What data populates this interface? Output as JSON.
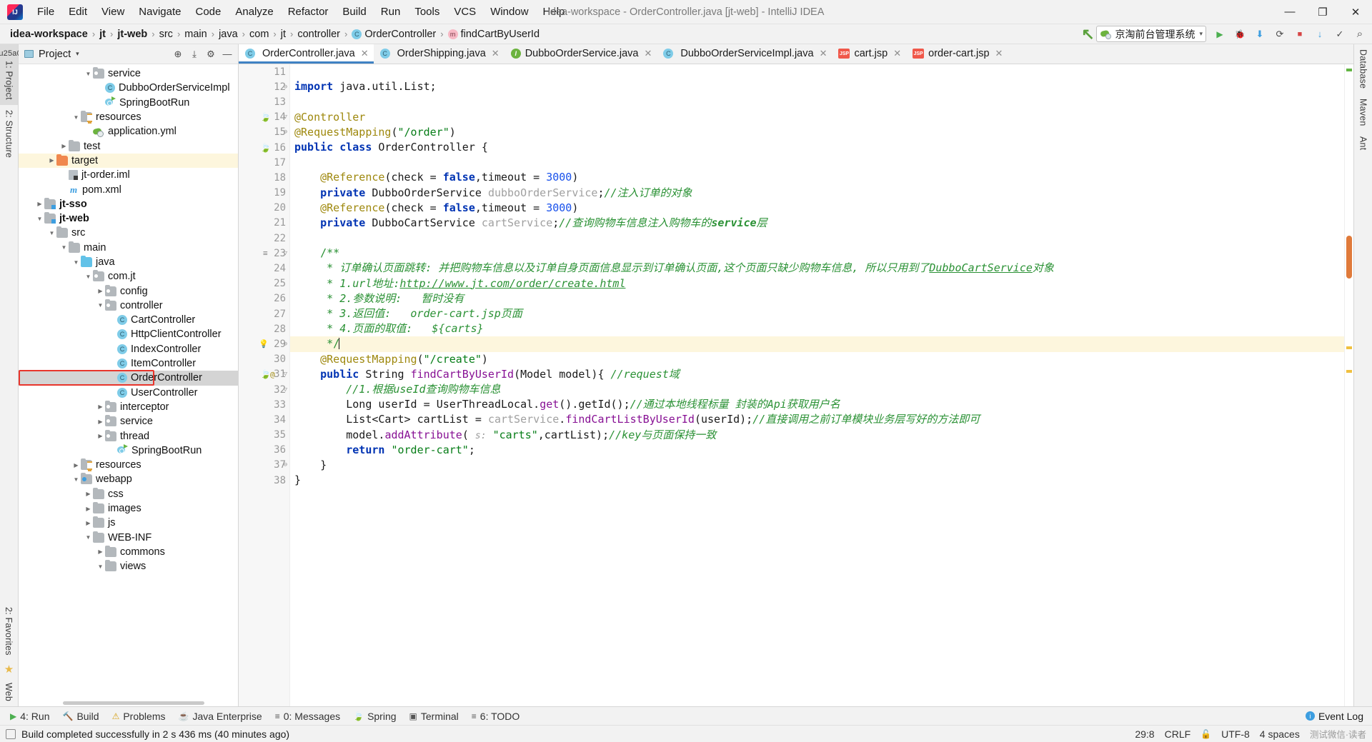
{
  "window": {
    "title": "idea-workspace - OrderController.java [jt-web] - IntelliJ IDEA",
    "minimize": "—",
    "maximize": "❐",
    "close": "✕"
  },
  "menu": [
    {
      "label": "File"
    },
    {
      "label": "Edit"
    },
    {
      "label": "View"
    },
    {
      "label": "Navigate"
    },
    {
      "label": "Code"
    },
    {
      "label": "Analyze"
    },
    {
      "label": "Refactor"
    },
    {
      "label": "Build"
    },
    {
      "label": "Run"
    },
    {
      "label": "Tools"
    },
    {
      "label": "VCS"
    },
    {
      "label": "Window"
    },
    {
      "label": "Help"
    }
  ],
  "breadcrumb": {
    "items": [
      {
        "label": "idea-workspace",
        "bold": true,
        "icon": null
      },
      {
        "label": "jt",
        "bold": true,
        "icon": null
      },
      {
        "label": "jt-web",
        "bold": true,
        "icon": null
      },
      {
        "label": "src",
        "bold": false,
        "icon": null
      },
      {
        "label": "main",
        "bold": false,
        "icon": null
      },
      {
        "label": "java",
        "bold": false,
        "icon": null
      },
      {
        "label": "com",
        "bold": false,
        "icon": null
      },
      {
        "label": "jt",
        "bold": false,
        "icon": null
      },
      {
        "label": "controller",
        "bold": false,
        "icon": null
      },
      {
        "label": "OrderController",
        "bold": false,
        "icon": "class-icon",
        "glyph": "C"
      },
      {
        "label": "findCartByUserId",
        "bold": false,
        "icon": "method-icon",
        "glyph": "m"
      }
    ],
    "separator": "›"
  },
  "toolbar": {
    "run_config": "京淘前台管理系统",
    "run_config_caret": "▾",
    "buttons": [
      {
        "name": "run-button",
        "glyph": "▶"
      },
      {
        "name": "debug-button",
        "glyph": "🐞"
      },
      {
        "name": "run-with-coverage-button",
        "glyph": "⬇"
      },
      {
        "name": "profile-button",
        "glyph": "⟳"
      },
      {
        "name": "stop-button",
        "glyph": "■"
      },
      {
        "name": "update-project-button",
        "glyph": "↓"
      },
      {
        "name": "commit-button",
        "glyph": "✓"
      },
      {
        "name": "search-everywhere-button",
        "glyph": "⌕"
      }
    ]
  },
  "left_rail": [
    {
      "label": "1: Project",
      "selected": true,
      "name": "tool-window-project"
    },
    {
      "label": "2: Structure",
      "selected": false,
      "name": "tool-window-structure"
    }
  ],
  "left_rail_bottom": [
    {
      "label": "2: Favorites",
      "name": "tool-window-favorites"
    },
    {
      "label": "Web",
      "name": "tool-window-web"
    }
  ],
  "right_rail": [
    {
      "label": "Database",
      "name": "tool-window-database"
    },
    {
      "label": "Maven",
      "name": "tool-window-maven"
    },
    {
      "label": "Ant",
      "name": "tool-window-ant"
    }
  ],
  "project_panel": {
    "title": "Project",
    "caret": "▾",
    "tools": [
      {
        "name": "select-opened-file-button",
        "glyph": "⊕"
      },
      {
        "name": "collapse-all-button",
        "glyph": "⤓"
      },
      {
        "name": "settings-gear-button",
        "glyph": "⚙"
      },
      {
        "name": "hide-panel-button",
        "glyph": "—"
      }
    ],
    "tree": [
      {
        "label": "service",
        "indent": 5,
        "twisty": "down",
        "icon": "package-folder",
        "state": "none"
      },
      {
        "label": "DubboOrderServiceImpl",
        "indent": 6,
        "twisty": "none",
        "icon": "class",
        "state": "none"
      },
      {
        "label": "SpringBootRun",
        "indent": 6,
        "twisty": "none",
        "icon": "spring-run",
        "state": "none"
      },
      {
        "label": "resources",
        "indent": 4,
        "twisty": "down",
        "icon": "resources-folder",
        "state": "none"
      },
      {
        "label": "application.yml",
        "indent": 5,
        "twisty": "none",
        "icon": "yml",
        "state": "none"
      },
      {
        "label": "test",
        "indent": 3,
        "twisty": "right",
        "icon": "gray-folder",
        "state": "none"
      },
      {
        "label": "target",
        "indent": 2,
        "twisty": "right",
        "icon": "orange-folder",
        "state": "highlight"
      },
      {
        "label": "jt-order.iml",
        "indent": 3,
        "twisty": "none",
        "icon": "iml",
        "state": "none"
      },
      {
        "label": "pom.xml",
        "indent": 3,
        "twisty": "none",
        "icon": "maven",
        "state": "none"
      },
      {
        "label": "jt-sso",
        "indent": 1,
        "twisty": "right",
        "icon": "module-folder",
        "state": "none",
        "bold": true
      },
      {
        "label": "jt-web",
        "indent": 1,
        "twisty": "down",
        "icon": "module-folder",
        "state": "none",
        "bold": true
      },
      {
        "label": "src",
        "indent": 2,
        "twisty": "down",
        "icon": "gray-folder",
        "state": "none"
      },
      {
        "label": "main",
        "indent": 3,
        "twisty": "down",
        "icon": "gray-folder",
        "state": "none"
      },
      {
        "label": "java",
        "indent": 4,
        "twisty": "down",
        "icon": "blue-folder",
        "state": "none"
      },
      {
        "label": "com.jt",
        "indent": 5,
        "twisty": "down",
        "icon": "package-folder",
        "state": "none"
      },
      {
        "label": "config",
        "indent": 6,
        "twisty": "right",
        "icon": "package-folder",
        "state": "none"
      },
      {
        "label": "controller",
        "indent": 6,
        "twisty": "down",
        "icon": "package-folder",
        "state": "none"
      },
      {
        "label": "CartController",
        "indent": 7,
        "twisty": "none",
        "icon": "class",
        "state": "none"
      },
      {
        "label": "HttpClientController",
        "indent": 7,
        "twisty": "none",
        "icon": "class",
        "state": "none"
      },
      {
        "label": "IndexController",
        "indent": 7,
        "twisty": "none",
        "icon": "class",
        "state": "none"
      },
      {
        "label": "ItemController",
        "indent": 7,
        "twisty": "none",
        "icon": "class",
        "state": "none"
      },
      {
        "label": "OrderController",
        "indent": 7,
        "twisty": "none",
        "icon": "class",
        "state": "selected"
      },
      {
        "label": "UserController",
        "indent": 7,
        "twisty": "none",
        "icon": "class",
        "state": "none"
      },
      {
        "label": "interceptor",
        "indent": 6,
        "twisty": "right",
        "icon": "package-folder",
        "state": "none"
      },
      {
        "label": "service",
        "indent": 6,
        "twisty": "right",
        "icon": "package-folder",
        "state": "none"
      },
      {
        "label": "thread",
        "indent": 6,
        "twisty": "right",
        "icon": "package-folder",
        "state": "none"
      },
      {
        "label": "SpringBootRun",
        "indent": 7,
        "twisty": "none",
        "icon": "spring-run",
        "state": "none"
      },
      {
        "label": "resources",
        "indent": 4,
        "twisty": "right",
        "icon": "resources-folder",
        "state": "none"
      },
      {
        "label": "webapp",
        "indent": 4,
        "twisty": "down",
        "icon": "webapp-folder",
        "state": "none"
      },
      {
        "label": "css",
        "indent": 5,
        "twisty": "right",
        "icon": "gray-folder",
        "state": "none"
      },
      {
        "label": "images",
        "indent": 5,
        "twisty": "right",
        "icon": "gray-folder",
        "state": "none"
      },
      {
        "label": "js",
        "indent": 5,
        "twisty": "right",
        "icon": "gray-folder",
        "state": "none"
      },
      {
        "label": "WEB-INF",
        "indent": 5,
        "twisty": "down",
        "icon": "gray-folder",
        "state": "none"
      },
      {
        "label": "commons",
        "indent": 6,
        "twisty": "right",
        "icon": "gray-folder",
        "state": "none"
      },
      {
        "label": "views",
        "indent": 6,
        "twisty": "down",
        "icon": "gray-folder",
        "state": "none"
      }
    ]
  },
  "editor_tabs": [
    {
      "label": "OrderController.java",
      "icon": "class",
      "active": true,
      "close": "✕"
    },
    {
      "label": "OrderShipping.java",
      "icon": "class",
      "active": false,
      "close": "✕"
    },
    {
      "label": "DubboOrderService.java",
      "icon": "interface",
      "active": false,
      "close": "✕"
    },
    {
      "label": "DubboOrderServiceImpl.java",
      "icon": "class",
      "active": false,
      "close": "✕"
    },
    {
      "label": "cart.jsp",
      "icon": "jsp",
      "active": false,
      "close": "✕"
    },
    {
      "label": "order-cart.jsp",
      "icon": "jsp",
      "active": false,
      "close": "✕"
    }
  ],
  "code": {
    "first_line": 11,
    "lines": [
      {
        "n": 11,
        "html": ""
      },
      {
        "n": 12,
        "html": "<span class=\"kw\">import</span> java.util.List;",
        "fold": "minus"
      },
      {
        "n": 13,
        "html": ""
      },
      {
        "n": 14,
        "html": "<span class=\"ann\">@Controller</span>",
        "gutter": "spring-bean",
        "fold": "tri"
      },
      {
        "n": 15,
        "html": "<span class=\"ann\">@RequestMapping</span>(<span class=\"str\">\"/order\"</span>)",
        "fold": "minus"
      },
      {
        "n": 16,
        "html": "<span class=\"kw\">public class</span> <span class=\"ident\">OrderController</span> {",
        "gutter": "spring-class"
      },
      {
        "n": 17,
        "html": ""
      },
      {
        "n": 18,
        "html": "    <span class=\"ann\">@Reference</span>(check = <span class=\"kw\">false</span>,timeout = <span class=\"num\">3000</span>)"
      },
      {
        "n": 19,
        "html": "    <span class=\"kw\">private</span> <span class=\"ident\">DubboOrderService</span> <span class=\"gray\">dubboOrderService</span>;<span class=\"jdoc\">//注入订单的对象</span>"
      },
      {
        "n": 20,
        "html": "    <span class=\"ann\">@Reference</span>(check = <span class=\"kw\">false</span>,timeout = <span class=\"num\">3000</span>)"
      },
      {
        "n": 21,
        "html": "    <span class=\"kw\">private</span> <span class=\"ident\">DubboCartService</span> <span class=\"gray\">cartService</span>;<span class=\"jdoc\">//查询购物车信息注入购物车的<b>service</b>层</span>"
      },
      {
        "n": 22,
        "html": ""
      },
      {
        "n": 23,
        "html": "    <span class=\"jdoc-b\">/**</span>",
        "gutter": "doc",
        "fold": "tri"
      },
      {
        "n": 24,
        "html": "     <span class=\"jdoc-b\">*</span> <span class=\"jdoc\">订单确认页面跳转: 并把购物车信息以及订单自身页面信息显示到订单确认页面,这个页面只缺少购物车信息, 所以只用到了</span><span class=\"link\">DubboCartService</span><span class=\"jdoc\">对象</span>"
      },
      {
        "n": 25,
        "html": "     <span class=\"jdoc-b\">*</span> <span class=\"jdoc\">1.url地址:</span><span class=\"link\">http://www.jt.com/order/create.html</span>"
      },
      {
        "n": 26,
        "html": "     <span class=\"jdoc-b\">*</span> <span class=\"jdoc\">2.参数说明:   暂时没有</span>"
      },
      {
        "n": 27,
        "html": "     <span class=\"jdoc-b\">*</span> <span class=\"jdoc\">3.返回值:   order-cart.jsp页面</span>"
      },
      {
        "n": 28,
        "html": "     <span class=\"jdoc-b\">*</span> <span class=\"jdoc\">4.页面的取值:   ${carts}</span>"
      },
      {
        "n": 29,
        "html": "     <span class=\"jdoc-b\">*/</span><span class=\"caret-bar\"></span>",
        "gutter": "bulb",
        "fold": "minus",
        "highlight": true
      },
      {
        "n": 30,
        "html": "    <span class=\"ann\">@RequestMapping</span>(<span class=\"str\">\"/create\"</span>)"
      },
      {
        "n": 31,
        "html": "    <span class=\"kw\">public</span> <span class=\"ident\">String</span> <span class=\"field\">findCartByUserId</span>(<span class=\"ident\">Model</span> model){ <span class=\"jdoc\">//request域</span>",
        "gutter": "spring-mapping",
        "fold": "tri"
      },
      {
        "n": 32,
        "html": "        <span class=\"jdoc\">//1.根据useId查询购物车信息</span>",
        "fold": "tri2"
      },
      {
        "n": 33,
        "html": "        <span class=\"ident\">Long</span> userId = <span class=\"ident\">UserThreadLocal</span>.<span class=\"field\">get</span>().getId();<span class=\"jdoc\">//通过本地线程标量 封装的Api获取用户名</span>"
      },
      {
        "n": 34,
        "html": "        <span class=\"ident\">List</span>&lt;<span class=\"ident\">Cart</span>&gt; cartList = <span class=\"gray\">cartService</span>.<span class=\"field\">findCartListByUserId</span>(userId);<span class=\"jdoc\">//直接调用之前订单模块业务层写好的方法即可</span>"
      },
      {
        "n": 35,
        "html": "        model.<span class=\"field\">addAttribute</span>( <span class=\"hint\">s:</span> <span class=\"str\">\"carts\"</span>,cartList);<span class=\"jdoc\">//key与页面保持一致</span>"
      },
      {
        "n": 36,
        "html": "        <span class=\"kw\">return</span> <span class=\"str\">\"order-cart\"</span>;"
      },
      {
        "n": 37,
        "html": "    }",
        "fold": "minus"
      },
      {
        "n": 38,
        "html": "}"
      }
    ]
  },
  "bottom_bar": {
    "items": [
      {
        "label": "4: Run",
        "glyph": "▶",
        "name": "bottom-tab-run"
      },
      {
        "label": "Build",
        "glyph": "🔨",
        "name": "bottom-tab-build"
      },
      {
        "label": "Problems",
        "glyph": "⚠",
        "name": "bottom-tab-problems"
      },
      {
        "label": "Java Enterprise",
        "glyph": "☕",
        "name": "bottom-tab-java-enterprise"
      },
      {
        "label": "0: Messages",
        "glyph": "≡",
        "name": "bottom-tab-messages"
      },
      {
        "label": "Spring",
        "glyph": "🍃",
        "name": "bottom-tab-spring"
      },
      {
        "label": "Terminal",
        "glyph": "▣",
        "name": "bottom-tab-terminal"
      },
      {
        "label": "6: TODO",
        "glyph": "≡",
        "name": "bottom-tab-todo"
      }
    ],
    "event_log": "Event Log"
  },
  "status_bar": {
    "message": "Build completed successfully in 2 s 436 ms (40 minutes ago)",
    "caret_position": "29:8",
    "line_separator": "CRLF",
    "encoding": "UTF-8",
    "indent": "4 spaces",
    "watermark": "测试微信·读者"
  },
  "colors": {
    "accent": "#4082c4",
    "selection_box": "#e8352c",
    "highlight_row": "#fdf6dd",
    "keyword": "#0033b3",
    "string": "#067d17",
    "comment": "#8c8c8c",
    "javadoc": "#2a9134",
    "annotation": "#9e880d",
    "number": "#1750eb"
  }
}
